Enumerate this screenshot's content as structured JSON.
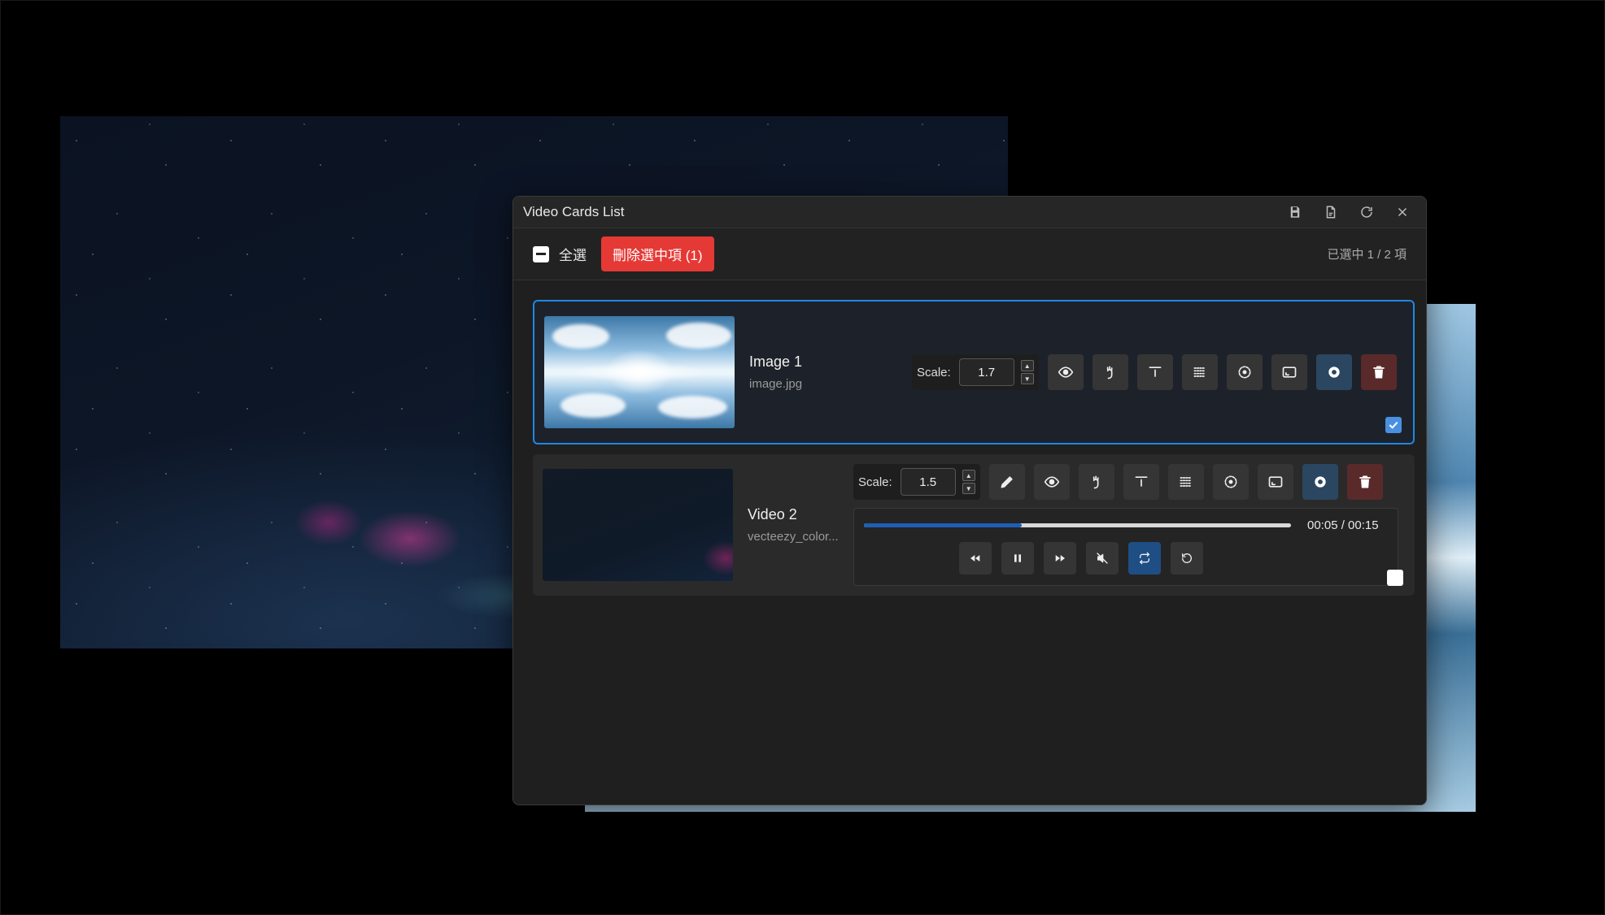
{
  "window": {
    "title": "Video Cards List"
  },
  "toolbar": {
    "select_all_label": "全選",
    "delete_selected_label": "刪除選中項 (1)",
    "selection_count": "已選中 1 / 2 項"
  },
  "cards": [
    {
      "title": "Image 1",
      "subtitle": "image.jpg",
      "scale_label": "Scale:",
      "scale_value": "1.7",
      "selected": true
    },
    {
      "title": "Video 2",
      "subtitle": "vecteezy_color...",
      "scale_label": "Scale:",
      "scale_value": "1.5",
      "selected": false,
      "player": {
        "time": "00:05 / 00:15",
        "progress": 0.37,
        "loop_active": true
      }
    }
  ],
  "colors": {
    "accent": "#1e88e5",
    "delete": "#e53935",
    "progress": "#1e5fb5"
  }
}
